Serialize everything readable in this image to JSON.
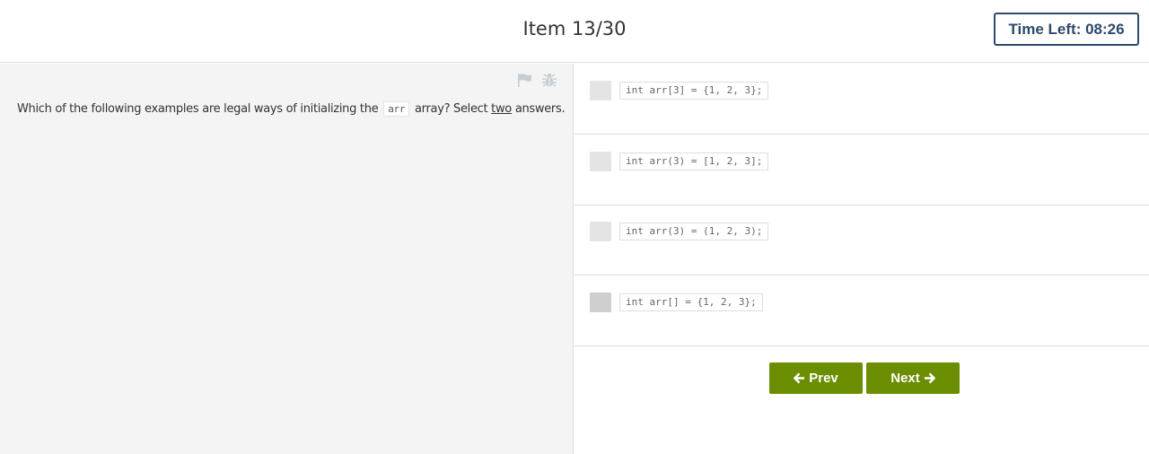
{
  "header": {
    "item_label": "Item 13/30",
    "timer_label": "Time Left: 08:26"
  },
  "question": {
    "prefix": "Which of the following examples are legal ways of initializing the",
    "code": "arr",
    "middle": "array? Select",
    "emphasis": "two",
    "suffix": "answers."
  },
  "tools": {
    "flag_icon": "flag-icon",
    "bug_icon": "bug-icon"
  },
  "options": [
    {
      "code": "int arr[3] = {1, 2, 3};",
      "checked": false
    },
    {
      "code": "int arr(3) = [1, 2, 3];",
      "checked": false
    },
    {
      "code": "int arr(3) = (1, 2, 3);",
      "checked": false
    },
    {
      "code": "int arr[] = {1, 2, 3};",
      "checked": false
    }
  ],
  "nav": {
    "prev_label": "Prev",
    "next_label": "Next"
  },
  "colors": {
    "accent": "#6b8e00",
    "timer_border": "#2d4a6b"
  }
}
